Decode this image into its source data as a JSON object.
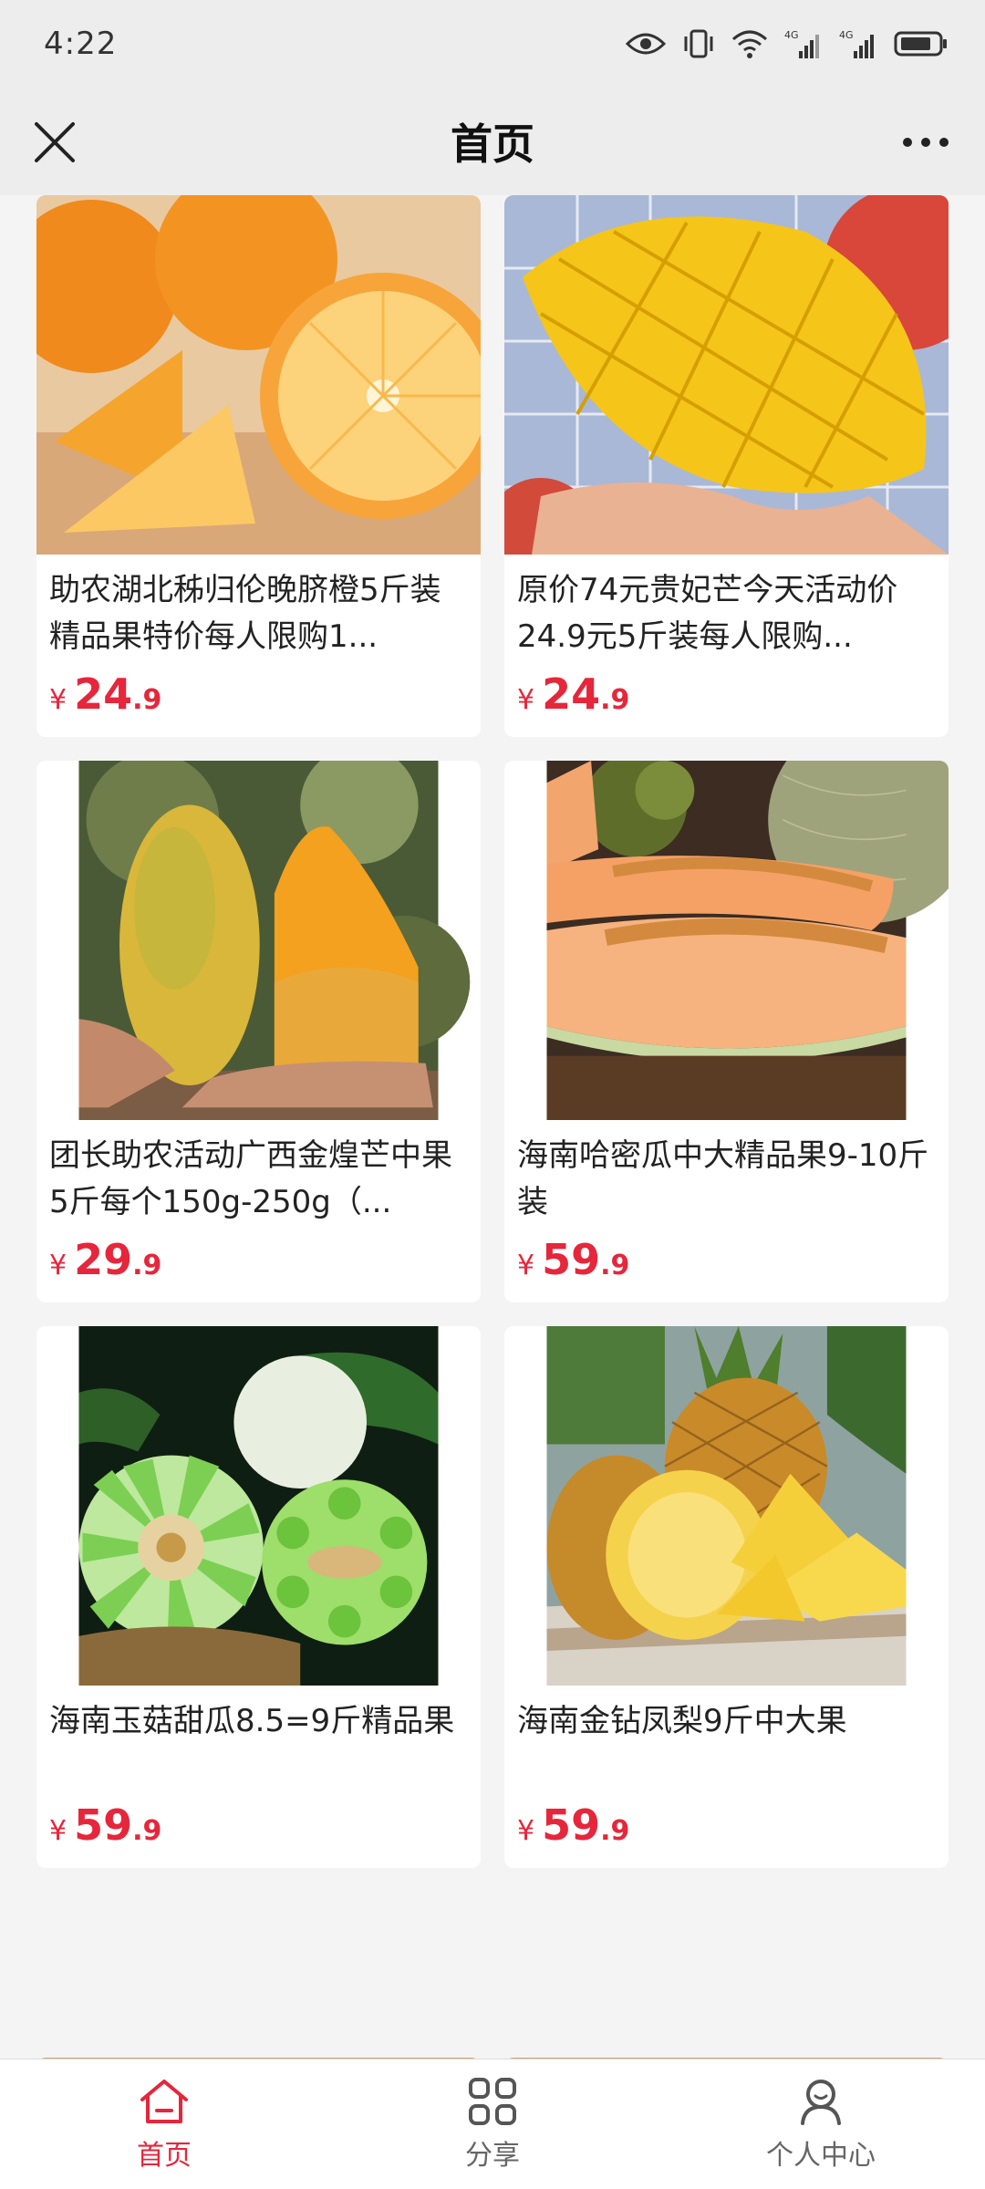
{
  "status_bar": {
    "time": "4:22"
  },
  "header": {
    "title": "首页"
  },
  "products": [
    {
      "name": "助农湖北秭归伦晚脐橙5斤装精品果特价每人限购1...",
      "currency": "¥",
      "price_int": "24",
      "price_dec": ".9"
    },
    {
      "name": "原价74元贵妃芒今天活动价24.9元5斤装每人限购...",
      "currency": "¥",
      "price_int": "24",
      "price_dec": ".9"
    },
    {
      "name": "团长助农活动广西金煌芒中果5斤每个150g-250g（...",
      "currency": "¥",
      "price_int": "29",
      "price_dec": ".9"
    },
    {
      "name": "海南哈密瓜中大精品果9-10斤装",
      "currency": "¥",
      "price_int": "59",
      "price_dec": ".9"
    },
    {
      "name": "海南玉菇甜瓜8.5=9斤精品果",
      "currency": "¥",
      "price_int": "59",
      "price_dec": ".9"
    },
    {
      "name": "海南金钻凤梨9斤中大果",
      "currency": "¥",
      "price_int": "59",
      "price_dec": ".9"
    }
  ],
  "bottom_nav": [
    {
      "label": "首页",
      "icon": "home-icon",
      "active": true
    },
    {
      "label": "分享",
      "icon": "grid-icon",
      "active": false
    },
    {
      "label": "个人中心",
      "icon": "user-icon",
      "active": false
    }
  ],
  "colors": {
    "accent": "#e6263b",
    "bar_bg": "#ededed",
    "page_bg": "#f4f4f4"
  }
}
